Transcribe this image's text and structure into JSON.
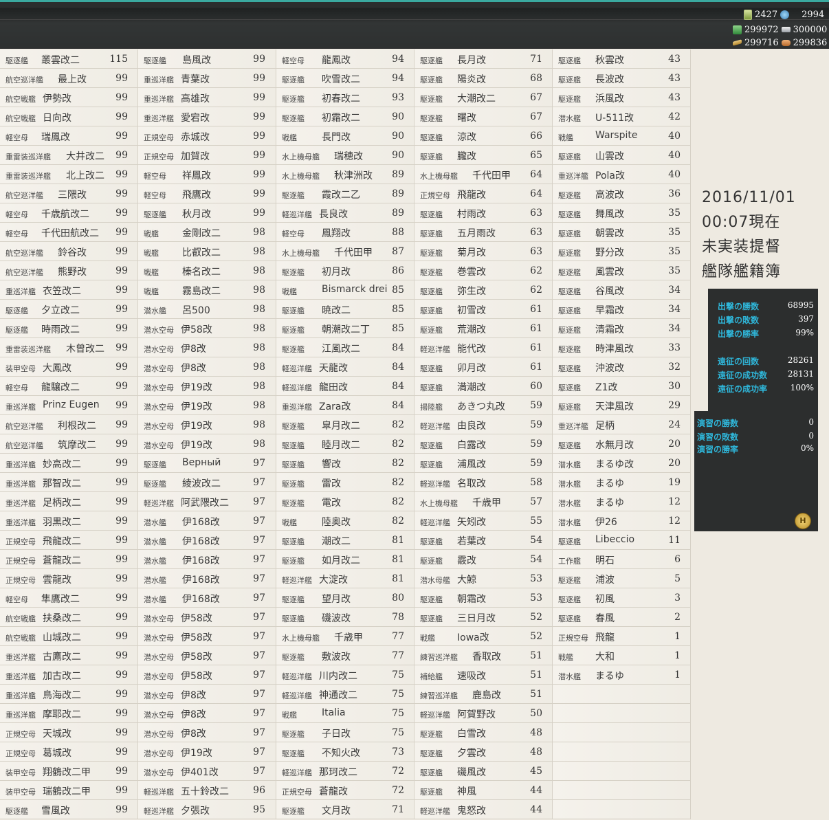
{
  "header": {
    "fuel_icon": "fuel-bucket-icon",
    "repair_icon": "repair-bucket-icon",
    "resources": {
      "row1": [
        "2427",
        "2994"
      ],
      "row2": [
        "299972",
        "300000"
      ],
      "row3": [
        "299716",
        "299836"
      ]
    }
  },
  "date": [
    "2016/11/01",
    "00:07現在",
    "未実装提督",
    "艦隊艦籍簿"
  ],
  "stats": {
    "sortie": [
      {
        "label": "出撃の勝数",
        "value": "68995"
      },
      {
        "label": "出撃の敗数",
        "value": "397"
      },
      {
        "label": "出撃の勝率",
        "value": "99%"
      }
    ],
    "expedition": [
      {
        "label": "遠征の回数",
        "value": "28261"
      },
      {
        "label": "遠征の成功数",
        "value": "28131"
      },
      {
        "label": "遠征の成功率",
        "value": "100%"
      }
    ],
    "exercise": [
      {
        "label": "演習の勝数",
        "value": "0"
      },
      {
        "label": "演習の敗数",
        "value": "0"
      },
      {
        "label": "演習の勝率",
        "value": "0%"
      }
    ]
  },
  "columns": [
    [
      [
        "駆逐艦",
        "叢雲改二",
        "115"
      ],
      [
        "航空巡洋艦",
        "最上改",
        "99"
      ],
      [
        "航空戦艦",
        "伊勢改",
        "99"
      ],
      [
        "航空戦艦",
        "日向改",
        "99"
      ],
      [
        "軽空母",
        "瑞鳳改",
        "99"
      ],
      [
        "重雷装巡洋艦",
        "大井改二",
        "99"
      ],
      [
        "重雷装巡洋艦",
        "北上改二",
        "99"
      ],
      [
        "航空巡洋艦",
        "三隈改",
        "99"
      ],
      [
        "軽空母",
        "千歳航改二",
        "99"
      ],
      [
        "軽空母",
        "千代田航改二",
        "99"
      ],
      [
        "航空巡洋艦",
        "鈴谷改",
        "99"
      ],
      [
        "航空巡洋艦",
        "熊野改",
        "99"
      ],
      [
        "重巡洋艦",
        "衣笠改二",
        "99"
      ],
      [
        "駆逐艦",
        "夕立改二",
        "99"
      ],
      [
        "駆逐艦",
        "時雨改二",
        "99"
      ],
      [
        "重雷装巡洋艦",
        "木曾改二",
        "99"
      ],
      [
        "装甲空母",
        "大鳳改",
        "99"
      ],
      [
        "軽空母",
        "龍驤改二",
        "99"
      ],
      [
        "重巡洋艦",
        "Prinz Eugen",
        "99"
      ],
      [
        "航空巡洋艦",
        "利根改二",
        "99"
      ],
      [
        "航空巡洋艦",
        "筑摩改二",
        "99"
      ],
      [
        "重巡洋艦",
        "妙高改二",
        "99"
      ],
      [
        "重巡洋艦",
        "那智改二",
        "99"
      ],
      [
        "重巡洋艦",
        "足柄改二",
        "99"
      ],
      [
        "重巡洋艦",
        "羽黒改二",
        "99"
      ],
      [
        "正規空母",
        "飛龍改二",
        "99"
      ],
      [
        "正規空母",
        "蒼龍改二",
        "99"
      ],
      [
        "正規空母",
        "雲龍改",
        "99"
      ],
      [
        "軽空母",
        "隼鷹改二",
        "99"
      ],
      [
        "航空戦艦",
        "扶桑改二",
        "99"
      ],
      [
        "航空戦艦",
        "山城改二",
        "99"
      ],
      [
        "重巡洋艦",
        "古鷹改二",
        "99"
      ],
      [
        "重巡洋艦",
        "加古改二",
        "99"
      ],
      [
        "重巡洋艦",
        "鳥海改二",
        "99"
      ],
      [
        "重巡洋艦",
        "摩耶改二",
        "99"
      ],
      [
        "正規空母",
        "天城改",
        "99"
      ],
      [
        "正規空母",
        "葛城改",
        "99"
      ],
      [
        "装甲空母",
        "翔鶴改二甲",
        "99"
      ],
      [
        "装甲空母",
        "瑞鶴改二甲",
        "99"
      ],
      [
        "駆逐艦",
        "雪風改",
        "99"
      ]
    ],
    [
      [
        "駆逐艦",
        "島風改",
        "99"
      ],
      [
        "重巡洋艦",
        "青葉改",
        "99"
      ],
      [
        "重巡洋艦",
        "高雄改",
        "99"
      ],
      [
        "重巡洋艦",
        "愛宕改",
        "99"
      ],
      [
        "正規空母",
        "赤城改",
        "99"
      ],
      [
        "正規空母",
        "加賀改",
        "99"
      ],
      [
        "軽空母",
        "祥鳳改",
        "99"
      ],
      [
        "軽空母",
        "飛鷹改",
        "99"
      ],
      [
        "駆逐艦",
        "秋月改",
        "99"
      ],
      [
        "戦艦",
        "金剛改二",
        "98"
      ],
      [
        "戦艦",
        "比叡改二",
        "98"
      ],
      [
        "戦艦",
        "榛名改二",
        "98"
      ],
      [
        "戦艦",
        "霧島改二",
        "98"
      ],
      [
        "潜水艦",
        "呂500",
        "98"
      ],
      [
        "潜水空母",
        "伊58改",
        "98"
      ],
      [
        "潜水空母",
        "伊8改",
        "98"
      ],
      [
        "潜水空母",
        "伊8改",
        "98"
      ],
      [
        "潜水空母",
        "伊19改",
        "98"
      ],
      [
        "潜水空母",
        "伊19改",
        "98"
      ],
      [
        "潜水空母",
        "伊19改",
        "98"
      ],
      [
        "潜水空母",
        "伊19改",
        "98"
      ],
      [
        "駆逐艦",
        "Верный",
        "97"
      ],
      [
        "駆逐艦",
        "綾波改二",
        "97"
      ],
      [
        "軽巡洋艦",
        "阿武隈改二",
        "97"
      ],
      [
        "潜水艦",
        "伊168改",
        "97"
      ],
      [
        "潜水艦",
        "伊168改",
        "97"
      ],
      [
        "潜水艦",
        "伊168改",
        "97"
      ],
      [
        "潜水艦",
        "伊168改",
        "97"
      ],
      [
        "潜水艦",
        "伊168改",
        "97"
      ],
      [
        "潜水空母",
        "伊58改",
        "97"
      ],
      [
        "潜水空母",
        "伊58改",
        "97"
      ],
      [
        "潜水空母",
        "伊58改",
        "97"
      ],
      [
        "潜水空母",
        "伊58改",
        "97"
      ],
      [
        "潜水空母",
        "伊8改",
        "97"
      ],
      [
        "潜水空母",
        "伊8改",
        "97"
      ],
      [
        "潜水空母",
        "伊8改",
        "97"
      ],
      [
        "潜水空母",
        "伊19改",
        "97"
      ],
      [
        "潜水空母",
        "伊401改",
        "97"
      ],
      [
        "軽巡洋艦",
        "五十鈴改二",
        "96"
      ],
      [
        "軽巡洋艦",
        "夕張改",
        "95"
      ]
    ],
    [
      [
        "軽空母",
        "龍鳳改",
        "94"
      ],
      [
        "駆逐艦",
        "吹雪改二",
        "94"
      ],
      [
        "駆逐艦",
        "初春改二",
        "93"
      ],
      [
        "駆逐艦",
        "初霜改二",
        "90"
      ],
      [
        "戦艦",
        "長門改",
        "90"
      ],
      [
        "水上機母艦",
        "瑞穂改",
        "90"
      ],
      [
        "水上機母艦",
        "秋津洲改",
        "89"
      ],
      [
        "駆逐艦",
        "霞改二乙",
        "89"
      ],
      [
        "軽巡洋艦",
        "長良改",
        "89"
      ],
      [
        "軽空母",
        "鳳翔改",
        "88"
      ],
      [
        "水上機母艦",
        "千代田甲",
        "87"
      ],
      [
        "駆逐艦",
        "初月改",
        "86"
      ],
      [
        "戦艦",
        "Bismarck drei",
        "85"
      ],
      [
        "駆逐艦",
        "暁改二",
        "85"
      ],
      [
        "駆逐艦",
        "朝潮改二丁",
        "85"
      ],
      [
        "駆逐艦",
        "江風改二",
        "84"
      ],
      [
        "軽巡洋艦",
        "天龍改",
        "84"
      ],
      [
        "軽巡洋艦",
        "龍田改",
        "84"
      ],
      [
        "重巡洋艦",
        "Zara改",
        "84"
      ],
      [
        "駆逐艦",
        "皐月改二",
        "82"
      ],
      [
        "駆逐艦",
        "睦月改二",
        "82"
      ],
      [
        "駆逐艦",
        "響改",
        "82"
      ],
      [
        "駆逐艦",
        "雷改",
        "82"
      ],
      [
        "駆逐艦",
        "電改",
        "82"
      ],
      [
        "戦艦",
        "陸奥改",
        "82"
      ],
      [
        "駆逐艦",
        "潮改二",
        "81"
      ],
      [
        "駆逐艦",
        "如月改二",
        "81"
      ],
      [
        "軽巡洋艦",
        "大淀改",
        "81"
      ],
      [
        "駆逐艦",
        "望月改",
        "80"
      ],
      [
        "駆逐艦",
        "磯波改",
        "78"
      ],
      [
        "水上機母艦",
        "千歳甲",
        "77"
      ],
      [
        "駆逐艦",
        "敷波改",
        "77"
      ],
      [
        "軽巡洋艦",
        "川内改二",
        "75"
      ],
      [
        "軽巡洋艦",
        "神通改二",
        "75"
      ],
      [
        "戦艦",
        "Italia",
        "75"
      ],
      [
        "駆逐艦",
        "子日改",
        "75"
      ],
      [
        "駆逐艦",
        "不知火改",
        "73"
      ],
      [
        "軽巡洋艦",
        "那珂改二",
        "72"
      ],
      [
        "正規空母",
        "蒼龍改",
        "72"
      ],
      [
        "駆逐艦",
        "文月改",
        "71"
      ]
    ],
    [
      [
        "駆逐艦",
        "長月改",
        "71"
      ],
      [
        "駆逐艦",
        "陽炎改",
        "68"
      ],
      [
        "駆逐艦",
        "大潮改二",
        "67"
      ],
      [
        "駆逐艦",
        "曙改",
        "67"
      ],
      [
        "駆逐艦",
        "涼改",
        "66"
      ],
      [
        "駆逐艦",
        "朧改",
        "65"
      ],
      [
        "水上機母艦",
        "千代田甲",
        "64"
      ],
      [
        "正規空母",
        "飛龍改",
        "64"
      ],
      [
        "駆逐艦",
        "村雨改",
        "63"
      ],
      [
        "駆逐艦",
        "五月雨改",
        "63"
      ],
      [
        "駆逐艦",
        "菊月改",
        "63"
      ],
      [
        "駆逐艦",
        "巻雲改",
        "62"
      ],
      [
        "駆逐艦",
        "弥生改",
        "62"
      ],
      [
        "駆逐艦",
        "初雪改",
        "61"
      ],
      [
        "駆逐艦",
        "荒潮改",
        "61"
      ],
      [
        "軽巡洋艦",
        "能代改",
        "61"
      ],
      [
        "駆逐艦",
        "卯月改",
        "61"
      ],
      [
        "駆逐艦",
        "満潮改",
        "60"
      ],
      [
        "揚陸艦",
        "あきつ丸改",
        "59"
      ],
      [
        "軽巡洋艦",
        "由良改",
        "59"
      ],
      [
        "駆逐艦",
        "白露改",
        "59"
      ],
      [
        "駆逐艦",
        "浦風改",
        "59"
      ],
      [
        "軽巡洋艦",
        "名取改",
        "58"
      ],
      [
        "水上機母艦",
        "千歳甲",
        "57"
      ],
      [
        "軽巡洋艦",
        "矢矧改",
        "55"
      ],
      [
        "駆逐艦",
        "若葉改",
        "54"
      ],
      [
        "駆逐艦",
        "霰改",
        "54"
      ],
      [
        "潜水母艦",
        "大鯨",
        "53"
      ],
      [
        "駆逐艦",
        "朝霜改",
        "53"
      ],
      [
        "駆逐艦",
        "三日月改",
        "52"
      ],
      [
        "戦艦",
        "Iowa改",
        "52"
      ],
      [
        "練習巡洋艦",
        "香取改",
        "51"
      ],
      [
        "補給艦",
        "速吸改",
        "51"
      ],
      [
        "練習巡洋艦",
        "鹿島改",
        "51"
      ],
      [
        "軽巡洋艦",
        "阿賀野改",
        "50"
      ],
      [
        "駆逐艦",
        "白雪改",
        "48"
      ],
      [
        "駆逐艦",
        "夕雲改",
        "48"
      ],
      [
        "駆逐艦",
        "磯風改",
        "45"
      ],
      [
        "駆逐艦",
        "神風",
        "44"
      ],
      [
        "軽巡洋艦",
        "鬼怒改",
        "44"
      ]
    ],
    [
      [
        "駆逐艦",
        "秋雲改",
        "43"
      ],
      [
        "駆逐艦",
        "長波改",
        "43"
      ],
      [
        "駆逐艦",
        "浜風改",
        "43"
      ],
      [
        "潜水艦",
        "U-511改",
        "42"
      ],
      [
        "戦艦",
        "Warspite",
        "40"
      ],
      [
        "駆逐艦",
        "山雲改",
        "40"
      ],
      [
        "重巡洋艦",
        "Pola改",
        "40"
      ],
      [
        "駆逐艦",
        "高波改",
        "36"
      ],
      [
        "駆逐艦",
        "舞風改",
        "35"
      ],
      [
        "駆逐艦",
        "朝雲改",
        "35"
      ],
      [
        "駆逐艦",
        "野分改",
        "35"
      ],
      [
        "駆逐艦",
        "風雲改",
        "35"
      ],
      [
        "駆逐艦",
        "谷風改",
        "34"
      ],
      [
        "駆逐艦",
        "早霜改",
        "34"
      ],
      [
        "駆逐艦",
        "清霜改",
        "34"
      ],
      [
        "駆逐艦",
        "時津風改",
        "33"
      ],
      [
        "駆逐艦",
        "沖波改",
        "32"
      ],
      [
        "駆逐艦",
        "Z1改",
        "30"
      ],
      [
        "駆逐艦",
        "天津風改",
        "29"
      ],
      [
        "重巡洋艦",
        "足柄",
        "24"
      ],
      [
        "駆逐艦",
        "水無月改",
        "20"
      ],
      [
        "潜水艦",
        "まるゆ改",
        "20"
      ],
      [
        "潜水艦",
        "まるゆ",
        "19"
      ],
      [
        "潜水艦",
        "まるゆ",
        "12"
      ],
      [
        "潜水艦",
        "伊26",
        "12"
      ],
      [
        "駆逐艦",
        "Libeccio",
        "11"
      ],
      [
        "工作艦",
        "明石",
        "6"
      ],
      [
        "駆逐艦",
        "浦波",
        "5"
      ],
      [
        "駆逐艦",
        "初風",
        "3"
      ],
      [
        "駆逐艦",
        "春風",
        "2"
      ],
      [
        "正規空母",
        "飛龍",
        "1"
      ],
      [
        "戦艦",
        "大和",
        "1"
      ],
      [
        "潜水艦",
        "まるゆ",
        "1"
      ],
      [
        "",
        "",
        ""
      ],
      [
        "",
        "",
        ""
      ],
      [
        "",
        "",
        ""
      ],
      [
        "",
        "",
        ""
      ],
      [
        "",
        "",
        ""
      ],
      [
        "",
        "",
        ""
      ],
      [
        "",
        "",
        ""
      ]
    ]
  ]
}
